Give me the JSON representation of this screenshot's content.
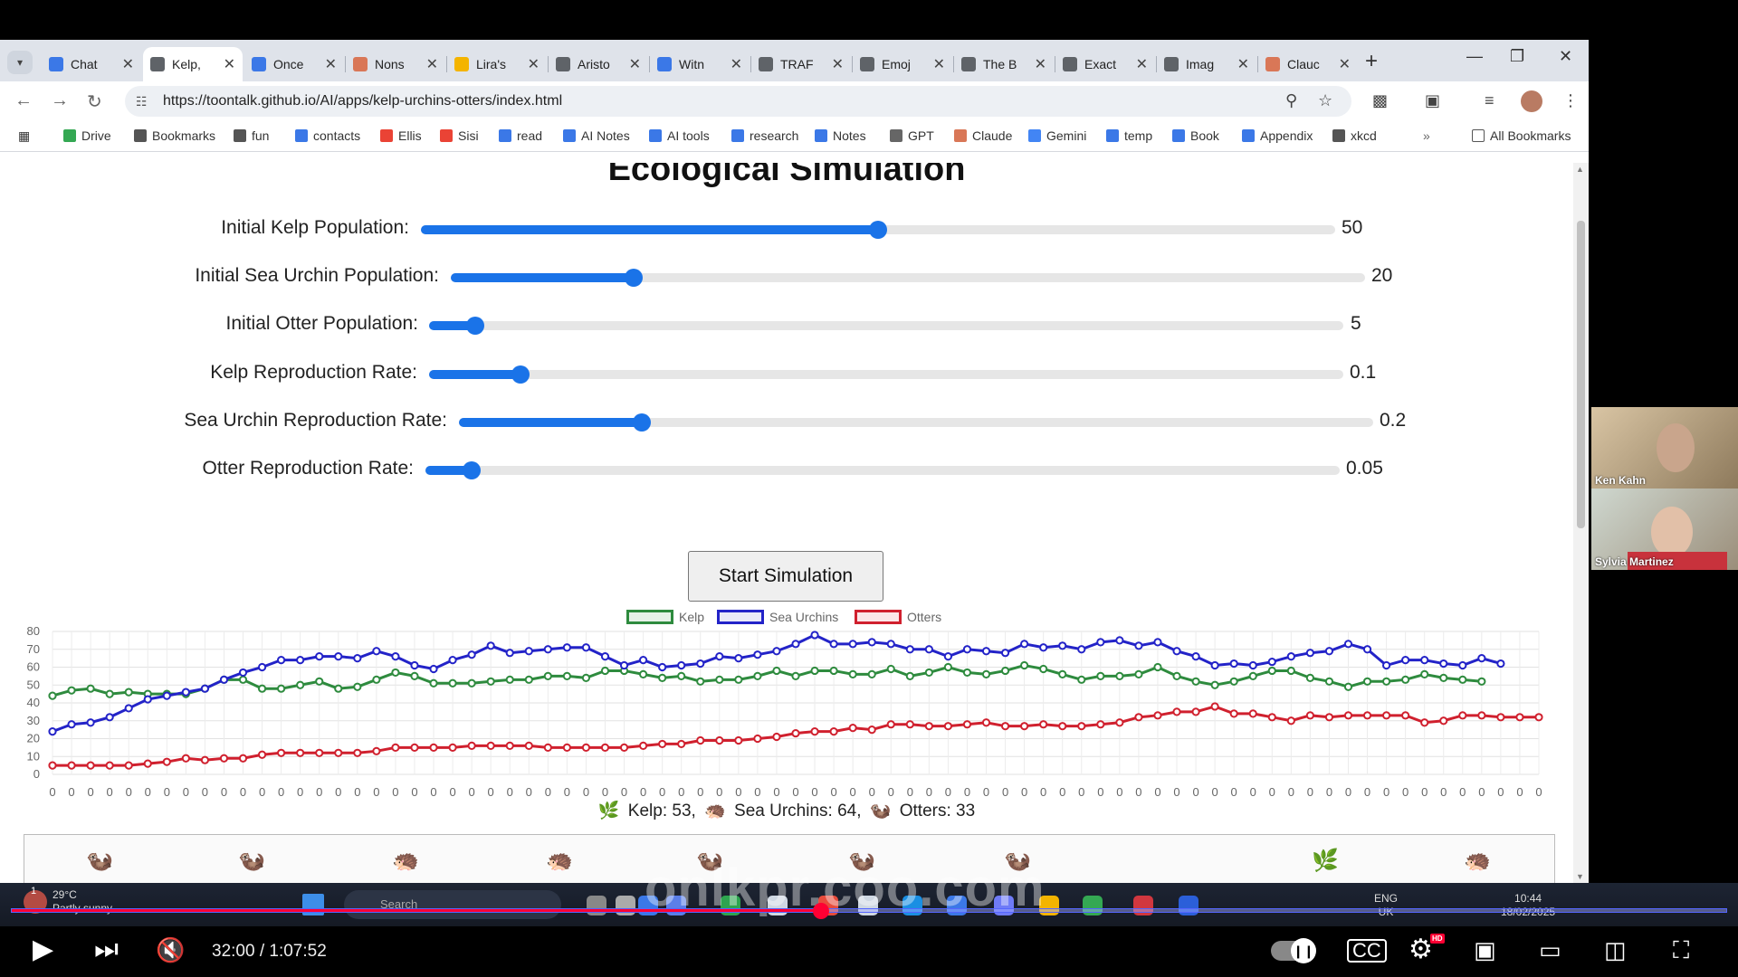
{
  "browser": {
    "tabs": [
      {
        "label": "Chat",
        "color": "#3b78e7"
      },
      {
        "label": "Kelp,",
        "color": "#5f6368",
        "active": true
      },
      {
        "label": "Once",
        "color": "#3b78e7"
      },
      {
        "label": "Nons",
        "color": "#d97757"
      },
      {
        "label": "Lira's",
        "color": "#f4b400"
      },
      {
        "label": "Aristo",
        "color": "#5f6368"
      },
      {
        "label": "Witn",
        "color": "#3b78e7"
      },
      {
        "label": "TRAF",
        "color": "#5f6368"
      },
      {
        "label": "Emoj",
        "color": "#5f6368"
      },
      {
        "label": "The B",
        "color": "#5f6368"
      },
      {
        "label": "Exact",
        "color": "#5f6368"
      },
      {
        "label": "Imag",
        "color": "#5f6368"
      },
      {
        "label": "Clauc",
        "color": "#d97757"
      }
    ],
    "url": "https://toontalk.github.io/AI/apps/kelp-urchins-otters/index.html",
    "bookmarks": [
      "Drive",
      "Bookmarks",
      "fun",
      "contacts",
      "Ellis",
      "Sisi",
      "read",
      "AI Notes",
      "AI tools",
      "research",
      "Notes",
      "GPT",
      "Claude",
      "Gemini",
      "temp",
      "Book",
      "Appendix",
      "xkcd"
    ],
    "all_bookmarks": "All Bookmarks"
  },
  "page": {
    "title": "Ecological Simulation",
    "sliders": [
      {
        "label": "Initial Kelp Population:",
        "value": "50",
        "fraction": 0.5
      },
      {
        "label": "Initial Sea Urchin Population:",
        "value": "20",
        "fraction": 0.2
      },
      {
        "label": "Initial Otter Population:",
        "value": "5",
        "fraction": 0.05
      },
      {
        "label": "Kelp Reproduction Rate:",
        "value": "0.1",
        "fraction": 0.1
      },
      {
        "label": "Sea Urchin Reproduction Rate:",
        "value": "0.2",
        "fraction": 0.2
      },
      {
        "label": "Otter Reproduction Rate:",
        "value": "0.05",
        "fraction": 0.05
      }
    ],
    "start_button": "Start Simulation",
    "counts": {
      "kelp": "Kelp: 53,",
      "urchins": "Sea Urchins: 64,",
      "otters": "Otters: 33"
    },
    "creatures": [
      "otter",
      "otter",
      "urchin",
      "urchin",
      "otter",
      "otter",
      "otter",
      "kelp",
      "urchin"
    ]
  },
  "chart_data": {
    "type": "line",
    "x_tick_label": "0",
    "ylim": [
      0,
      80
    ],
    "yticks": [
      0,
      10,
      20,
      30,
      40,
      50,
      60,
      70,
      80
    ],
    "grid": true,
    "legend_position": "top",
    "series": [
      {
        "name": "Kelp",
        "color": "#2e8b3e",
        "values": [
          44,
          47,
          48,
          45,
          46,
          45,
          45,
          45,
          48,
          53,
          53,
          48,
          48,
          50,
          52,
          48,
          49,
          53,
          57,
          55,
          51,
          51,
          51,
          52,
          53,
          53,
          55,
          55,
          54,
          58,
          58,
          56,
          54,
          55,
          52,
          53,
          53,
          55,
          58,
          55,
          58,
          58,
          56,
          56,
          59,
          55,
          57,
          60,
          57,
          56,
          58,
          61,
          59,
          56,
          53,
          55,
          55,
          56,
          60,
          55,
          52,
          50,
          52,
          55,
          58,
          58,
          54,
          52,
          49,
          52,
          52,
          53,
          56,
          54,
          53,
          52
        ]
      },
      {
        "name": "Sea Urchins",
        "color": "#2323c8",
        "values": [
          24,
          28,
          29,
          32,
          37,
          42,
          44,
          46,
          48,
          53,
          57,
          60,
          64,
          64,
          66,
          66,
          65,
          69,
          66,
          61,
          59,
          64,
          67,
          72,
          68,
          69,
          70,
          71,
          71,
          66,
          61,
          64,
          60,
          61,
          62,
          66,
          65,
          67,
          69,
          73,
          78,
          73,
          73,
          74,
          73,
          70,
          70,
          66,
          70,
          69,
          68,
          73,
          71,
          72,
          70,
          74,
          75,
          72,
          74,
          69,
          66,
          61,
          62,
          61,
          63,
          66,
          68,
          69,
          73,
          70,
          61,
          64,
          64,
          62,
          61,
          65,
          62
        ]
      },
      {
        "name": "Otters",
        "color": "#d0202e",
        "values": [
          5,
          5,
          5,
          5,
          5,
          6,
          7,
          9,
          8,
          9,
          9,
          11,
          12,
          12,
          12,
          12,
          12,
          13,
          15,
          15,
          15,
          15,
          16,
          16,
          16,
          16,
          15,
          15,
          15,
          15,
          15,
          16,
          17,
          17,
          19,
          19,
          19,
          20,
          21,
          23,
          24,
          24,
          26,
          25,
          28,
          28,
          27,
          27,
          28,
          29,
          27,
          27,
          28,
          27,
          27,
          28,
          29,
          32,
          33,
          35,
          35,
          38,
          34,
          34,
          32,
          30,
          33,
          32,
          33,
          33,
          33,
          33,
          29,
          30,
          33,
          33,
          32,
          32,
          32
        ]
      }
    ]
  },
  "taskbar": {
    "temp": "29°C",
    "weather": "Partly sunny",
    "search": "Search",
    "lang": "ENG",
    "region": "UK",
    "time": "10:44",
    "date": "18/02/2025",
    "watermark": "onlkpr.coo.com",
    "badge": "1"
  },
  "player": {
    "time": "32:00 / 1:07:52",
    "progress": 0.4716
  },
  "participants": [
    {
      "name": "Ken Kahn"
    },
    {
      "name": "Sylvia Martinez"
    }
  ]
}
